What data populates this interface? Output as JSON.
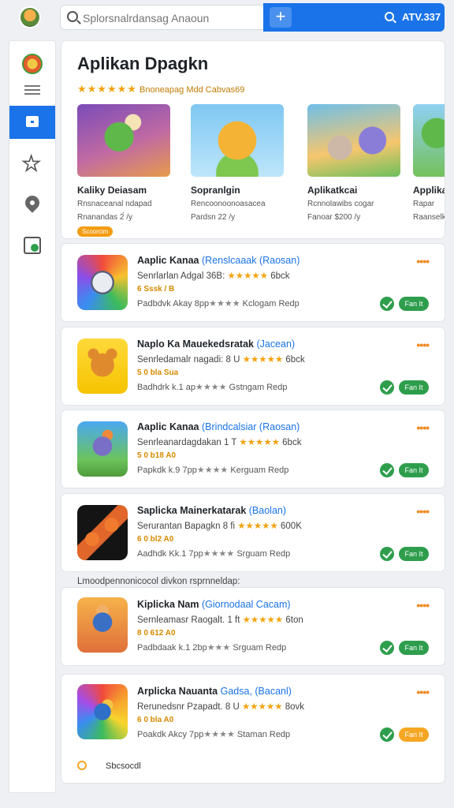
{
  "search": {
    "placeholder": "Splorsnalrdansag Anaoun"
  },
  "topbar": {
    "add_label": "+",
    "count": "ATV.337"
  },
  "featured": {
    "title": "Aplikan Dpagkn",
    "subtitle_stars": "★★★★★★",
    "subtitle": "Bnoneapag Mdd Cabvas69",
    "items": [
      {
        "name": "Kaliky Deiasam",
        "desc1": "Rnsnaceanal ndapad",
        "desc2": "Rnanandas 2́ /y",
        "pill": "Scoorcim"
      },
      {
        "name": "Sopranlgin",
        "desc1": "Rencoonoonoasacea",
        "desc2": "Pardsn 22 /y",
        "pill": ""
      },
      {
        "name": "Aplikatkcai",
        "desc1": "Rcnnolawibs cogar",
        "desc2": "Fanoar $200 /y",
        "pill": ""
      },
      {
        "name": "Applika",
        "desc1": "Rapar",
        "desc2": "Raanselk",
        "pill": ""
      }
    ]
  },
  "apps": [
    {
      "name": "Aaplic Kanaa",
      "tag": "(Renslcaaak (Raosan)",
      "sub": "Senrlarlan Adgal",
      "sub_tail": "36B:",
      "stars": "★★★★★",
      "sub_end": "6bck",
      "meta": "6 Sssk / B",
      "foot": "Padbdvk Akay 8pp",
      "foot_stars": "★★★★",
      "foot_end": "Kclogam Redp",
      "btn": "Fan It",
      "btn_color": "green"
    },
    {
      "name": "Naplo Ka Mauekedsratak",
      "tag": "(Jacean)",
      "sub": "Senrledamalr nagadi:",
      "sub_tail": "8 U",
      "stars": "★★★★★",
      "sub_end": "6bck",
      "meta": "5 0 bla Sua",
      "foot": "Badhdrk k.1 ap",
      "foot_stars": "★★★★",
      "foot_end": "Gstngam Redp",
      "btn": "Fan It",
      "btn_color": "green"
    },
    {
      "name": "Aaplic Kanaa",
      "tag": "(Brindcalsiar (Raosan)",
      "sub": "Senrleanardagdakan",
      "sub_tail": "1 T",
      "stars": "★★★★★",
      "sub_end": "6bck",
      "meta": "5 0 b18 A0",
      "foot": "Papkdk k.9 7pp",
      "foot_stars": "★★★★",
      "foot_end": "Kerguam Redp",
      "btn": "Fan It",
      "btn_color": "green"
    },
    {
      "name": "Saplicka Mainerkatarak",
      "tag": "(Baolan)",
      "sub": "Serurantan Bapagkn",
      "sub_tail": "8 fi",
      "stars": "★★★★★",
      "sub_end": "600K",
      "meta": "6 0 bl2 A0",
      "foot": "Aadhdk Kk.1 7pp",
      "foot_stars": "★★★★",
      "foot_end": "Srguam Redp",
      "btn": "Fan It",
      "btn_color": "green"
    },
    {
      "name": "Kiplicka Nam",
      "tag": "(Giornodaal Cacam)",
      "sub": "Sernleamasr Raogalt.",
      "sub_tail": "1 ft",
      "stars": "★★★★★",
      "sub_end": "6ton",
      "meta": "8 0 612 A0",
      "foot": "Padbdaak k.1 2bp",
      "foot_stars": "★★★",
      "foot_end": "Srguam Redp",
      "btn": "Fan It",
      "btn_color": "green"
    },
    {
      "name": "Arplicka Nauanta",
      "tag": "Gadsa, (Bacanl)",
      "sub": "Rerunedsnr Pzapadt.",
      "sub_tail": "8 U",
      "stars": "★★★★★",
      "sub_end": "8ovk",
      "meta": "6 0 bla A0",
      "foot": "Poakdk Akcy 7pp",
      "foot_stars": "★★★★",
      "foot_end": "Staman Redp",
      "btn": "Fan It",
      "btn_color": "orange"
    }
  ],
  "section_note": "Lmoodpennonicocol divkon rsprnneldap:",
  "footer": {
    "label": "Sbcsocdl"
  },
  "colors": {
    "accent": "#1a73e8",
    "star": "#f4a30f",
    "success": "#2e9e4d",
    "warning": "#f5a623"
  }
}
